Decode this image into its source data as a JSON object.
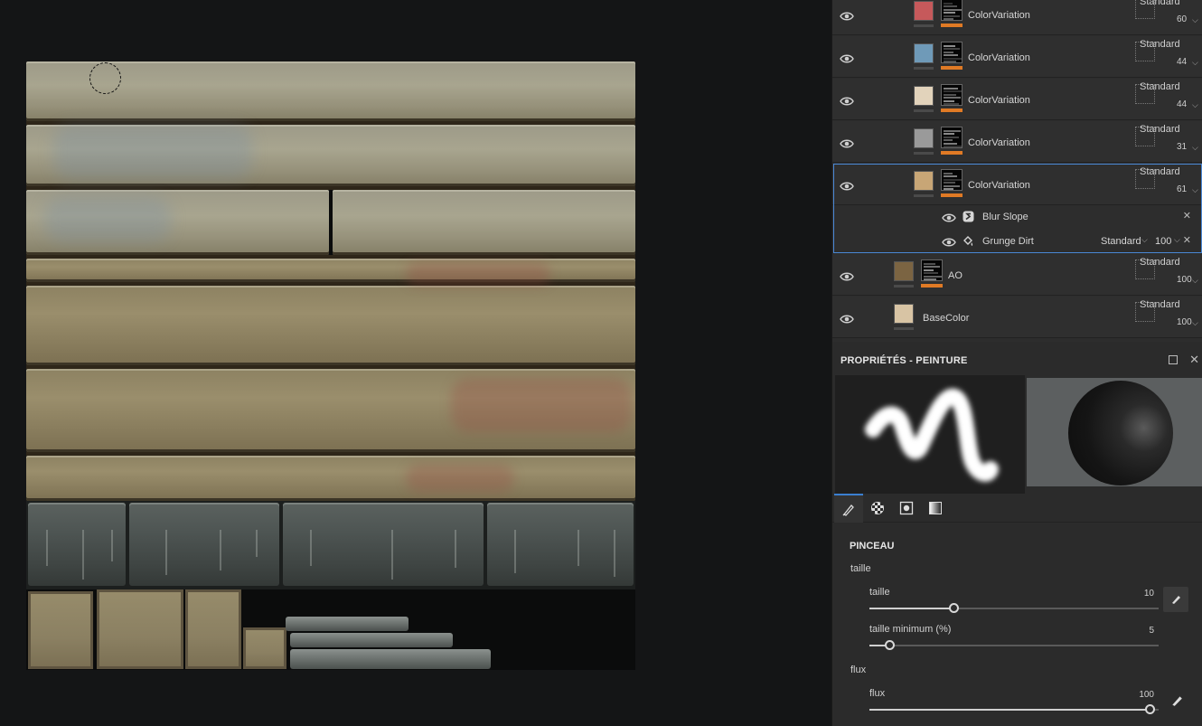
{
  "layers": [
    {
      "name": "ColorVariation",
      "blend": "Standard",
      "opacity": "60",
      "swatch": "#c6595b"
    },
    {
      "name": "ColorVariation",
      "blend": "Standard",
      "opacity": "44",
      "swatch": "#6f9ab8"
    },
    {
      "name": "ColorVariation",
      "blend": "Standard",
      "opacity": "44",
      "swatch": "#e2d3bb"
    },
    {
      "name": "ColorVariation",
      "blend": "Standard",
      "opacity": "31",
      "swatch": "#9a9a9a"
    },
    {
      "name": "ColorVariation",
      "blend": "Standard",
      "opacity": "61",
      "swatch": "#c8a676"
    },
    {
      "name": "AO",
      "blend": "Standard",
      "opacity": "100",
      "swatch": "#7b6442"
    },
    {
      "name": "BaseColor",
      "blend": "Standard",
      "opacity": "100",
      "swatch": "#d8c4a4"
    }
  ],
  "effects": [
    {
      "name": "Blur Slope",
      "icon": "blur-slope-icon"
    },
    {
      "name": "Grunge Dirt",
      "icon": "fill-bucket-icon",
      "blend": "Standard",
      "opacity": "100"
    }
  ],
  "properties": {
    "title": "PROPRIÉTÉS - PEINTURE",
    "section": "PINCEAU",
    "groups": {
      "size": {
        "label": "taille",
        "sliders": [
          {
            "label": "taille",
            "value": "10",
            "fraction": 0.3
          },
          {
            "label": "taille minimum (%)",
            "value": "5",
            "fraction": 0.07
          }
        ]
      },
      "flow": {
        "label": "flux",
        "sliders": [
          {
            "label": "flux",
            "value": "100",
            "fraction": 1.0
          }
        ]
      }
    }
  },
  "colors": {
    "accent": "#3b7fd0",
    "mask_bar": "#e07a25",
    "panel_bg": "#2b2b2b"
  }
}
